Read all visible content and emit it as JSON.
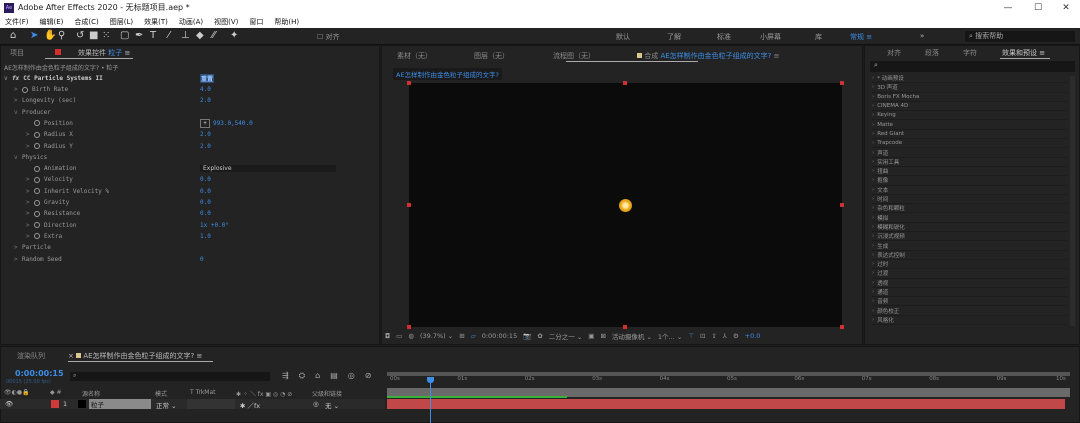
{
  "app": {
    "title": "Adobe After Effects 2020 - 无标题项目.aep *",
    "logo": "Ae"
  },
  "menu": [
    "文件(F)",
    "编辑(E)",
    "合成(C)",
    "图层(L)",
    "效果(T)",
    "动画(A)",
    "视图(V)",
    "窗口",
    "帮助(H)"
  ],
  "toolbar": {
    "align_label": "对齐",
    "workspaces": [
      "默认",
      "了解",
      "标准",
      "小屏幕",
      "库"
    ],
    "active_workspace": "常规",
    "search_placeholder": "搜索帮助"
  },
  "left_panel": {
    "tab_project": "项目",
    "tab_effects": "效果控件",
    "tab_effects_layer": "粒子",
    "breadcrumb": "AE怎样制作由金色粒子组成的文字? • 粒子",
    "effect_name": "CC Particle Systems II",
    "effect_reset": "重置",
    "properties": [
      {
        "label": "Birth Rate",
        "value": "4.0",
        "arrow": ">",
        "stopwatch": true,
        "indent": 1
      },
      {
        "label": "Longevity (sec)",
        "value": "2.0",
        "arrow": ">",
        "stopwatch": false,
        "indent": 1
      },
      {
        "label": "Producer",
        "value": "",
        "arrow": "v",
        "stopwatch": false,
        "indent": 1
      },
      {
        "label": "Position",
        "value": "993.0,540.0",
        "arrow": "",
        "stopwatch": true,
        "indent": 2
      },
      {
        "label": "Radius X",
        "value": "2.0",
        "arrow": ">",
        "stopwatch": true,
        "indent": 2
      },
      {
        "label": "Radius Y",
        "value": "2.0",
        "arrow": ">",
        "stopwatch": true,
        "indent": 2
      },
      {
        "label": "Physics",
        "value": "",
        "arrow": "v",
        "stopwatch": false,
        "indent": 1
      },
      {
        "label": "Animation",
        "value": "Explosive",
        "arrow": "",
        "stopwatch": true,
        "indent": 2
      },
      {
        "label": "Velocity",
        "value": "0.0",
        "arrow": ">",
        "stopwatch": true,
        "indent": 2
      },
      {
        "label": "Inherit Velocity %",
        "value": "0.0",
        "arrow": ">",
        "stopwatch": true,
        "indent": 2
      },
      {
        "label": "Gravity",
        "value": "0.0",
        "arrow": ">",
        "stopwatch": true,
        "indent": 2
      },
      {
        "label": "Resistance",
        "value": "0.0",
        "arrow": ">",
        "stopwatch": true,
        "indent": 2
      },
      {
        "label": "Direction",
        "value": "1x +0.0°",
        "arrow": ">",
        "stopwatch": true,
        "indent": 2
      },
      {
        "label": "Extra",
        "value": "1.0",
        "arrow": ">",
        "stopwatch": true,
        "indent": 2
      },
      {
        "label": "Particle",
        "value": "",
        "arrow": ">",
        "stopwatch": false,
        "indent": 1
      },
      {
        "label": "Random Seed",
        "value": "0",
        "arrow": ">",
        "stopwatch": false,
        "indent": 1
      }
    ]
  },
  "viewer": {
    "tabs": [
      "素材（无）",
      "图层（无）",
      "流程图（无）"
    ],
    "comp_tab_prefix": "合成",
    "comp_name": "AE怎样制作由金色粒子组成的文字?",
    "bottom": {
      "zoom": "(39.7%)",
      "timecode": "0:00:00:15",
      "resolution": "二分之一",
      "camera": "活动摄像机",
      "views": "1个...",
      "exposure": "+0.0"
    }
  },
  "right_panel": {
    "tabs": [
      "对齐",
      "段落",
      "字符",
      "效果和预设"
    ],
    "active_tab": "效果和预设",
    "items": [
      "* 动画预设",
      "3D 声道",
      "Boris FX Mocha",
      "CINEMA 4D",
      "Keying",
      "Matte",
      "Red Giant",
      "Trapcode",
      "声道",
      "实用工具",
      "扭曲",
      "抠像",
      "文本",
      "时间",
      "杂色和颗粒",
      "模拟",
      "模糊和锐化",
      "沉浸式视频",
      "生成",
      "表达式控制",
      "过时",
      "过渡",
      "透视",
      "通道",
      "音频",
      "颜色校正",
      "风格化"
    ]
  },
  "timeline": {
    "tab_render": "渲染队列",
    "comp_name": "AE怎样制作由金色粒子组成的文字?",
    "timecode": "0:00:00:15",
    "fps": "00015 (25.00 fps)",
    "columns": {
      "source": "源名称",
      "mode": "模式",
      "trkmat": "T  TrkMat",
      "parent": "父级和链接"
    },
    "layer": {
      "index": "1",
      "name": "粒子",
      "mode": "正常",
      "parent": "无",
      "color": "#d23a3a"
    },
    "ruler": [
      "00s",
      "01s",
      "02s",
      "03s",
      "04s",
      "05s",
      "06s",
      "07s",
      "08s",
      "09s",
      "10s"
    ],
    "current_time_seconds": 0.6
  },
  "colors": {
    "accent": "#3d8ee8",
    "layer_bar": "#c04848",
    "handle": "#d03030",
    "particle": "#f0b020"
  }
}
